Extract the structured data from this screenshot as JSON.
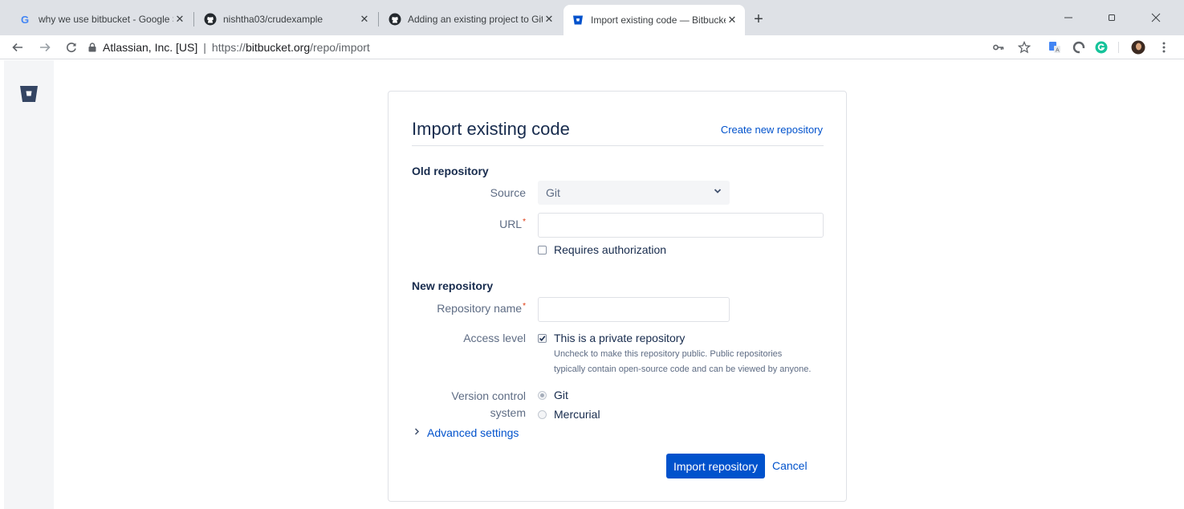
{
  "browser": {
    "tabs": [
      {
        "title": "why we use bitbucket - Google S",
        "favicon": "google-icon"
      },
      {
        "title": "nishtha03/crudexample",
        "favicon": "github-icon"
      },
      {
        "title": "Adding an existing project to Git",
        "favicon": "github-icon"
      },
      {
        "title": "Import existing code — Bitbucke",
        "favicon": "bitbucket-icon",
        "active": true
      }
    ],
    "new_tab": "+",
    "address": {
      "org": "Atlassian, Inc. [US]",
      "separator": "|",
      "url_prefix": "https://",
      "url_host": "bitbucket.org",
      "url_path": "/repo/import"
    }
  },
  "page": {
    "heading": "Import existing code",
    "create_link": "Create new repository",
    "old_repo": {
      "title": "Old repository",
      "source_label": "Source",
      "source_value": "Git",
      "url_label": "URL",
      "url_value": "",
      "requires_auth": "Requires authorization"
    },
    "new_repo": {
      "title": "New repository",
      "name_label": "Repository name",
      "name_value": "",
      "access_label": "Access level",
      "private_label": "This is a private repository",
      "private_help_1": "Uncheck to make this repository public. Public repositories",
      "private_help_2": "typically contain open-source code and can be viewed by anyone.",
      "vcs_label_1": "Version control",
      "vcs_label_2": "system",
      "vcs_git": "Git",
      "vcs_mercurial": "Mercurial"
    },
    "advanced": "Advanced settings",
    "import_button": "Import repository",
    "cancel": "Cancel",
    "required_mark": "*"
  },
  "colors": {
    "accent": "#0052cc",
    "required": "#de350b",
    "sidebar": "#f4f5f7"
  }
}
